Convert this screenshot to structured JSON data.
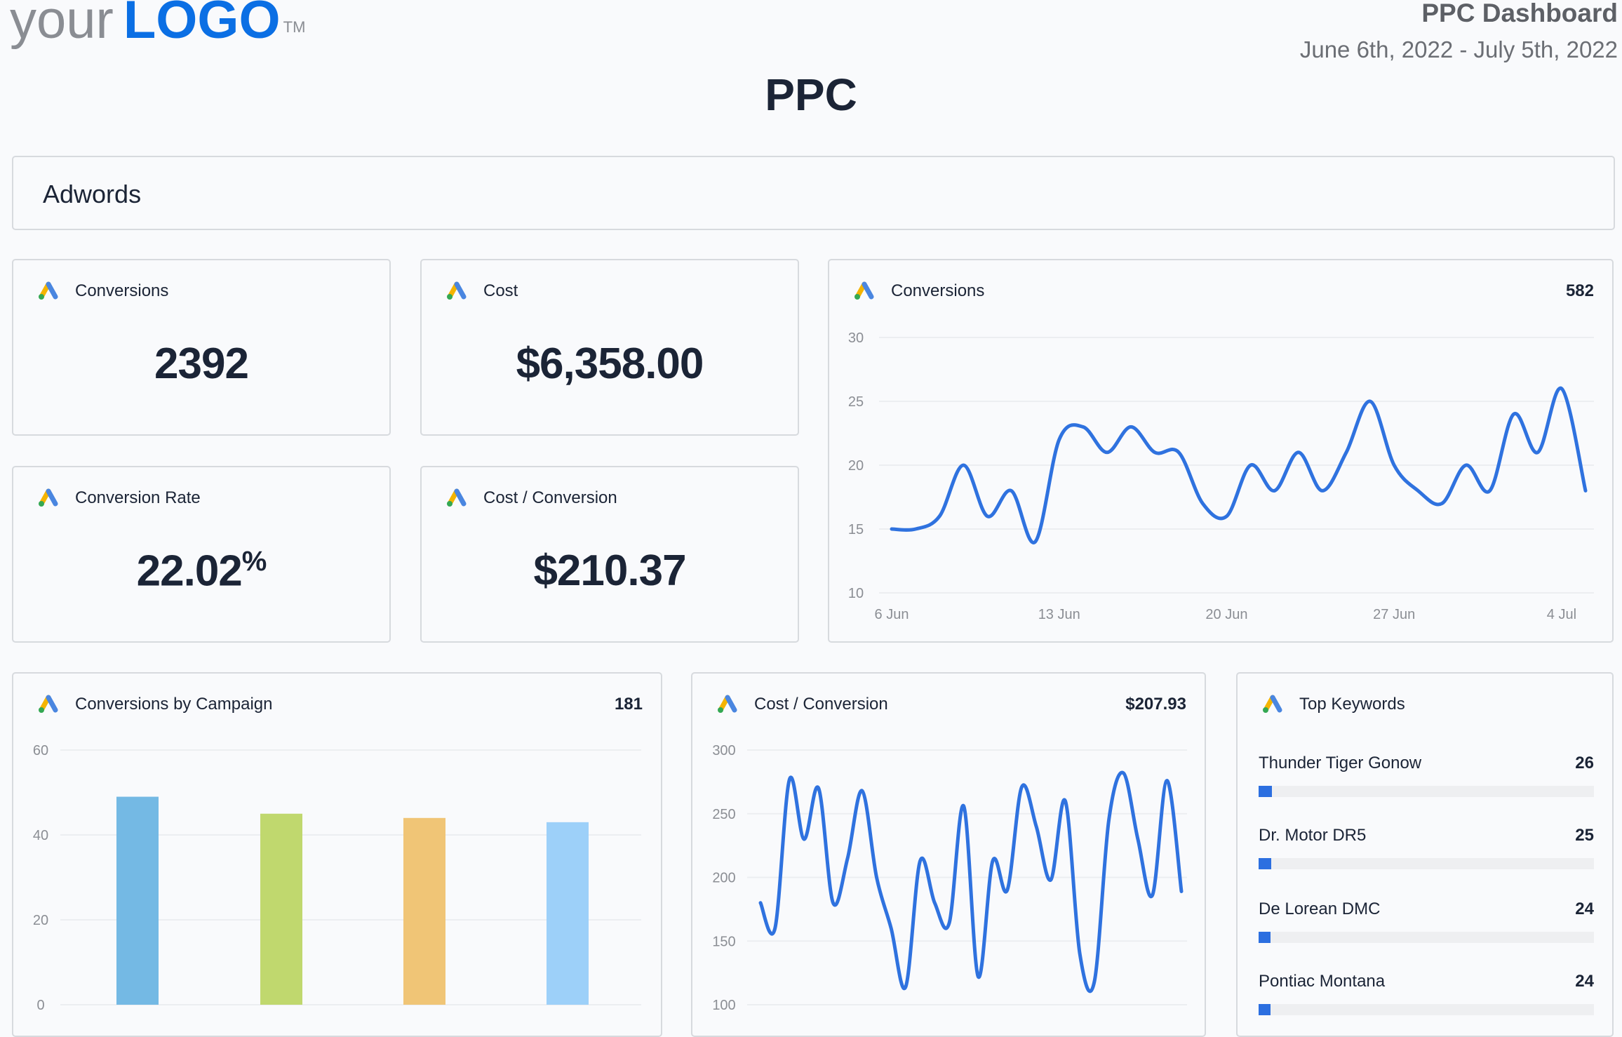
{
  "header": {
    "logo": {
      "prefix": "your",
      "brand": "LOGO",
      "tm": "TM"
    },
    "dashboard_title": "PPC Dashboard",
    "date_range": "June 6th, 2022 - July 5th, 2022",
    "page_title": "PPC"
  },
  "section": {
    "title": "Adwords"
  },
  "colors": {
    "accent": "#2c6fe0",
    "line": "#2f72df",
    "logo_blue": "#0b6fe4",
    "text": "#1b2436"
  },
  "icon": "google-ads-icon",
  "kpis": [
    {
      "title": "Conversions",
      "value": "2392"
    },
    {
      "title": "Cost",
      "value": "$6,358.00"
    },
    {
      "title": "Conversion Rate",
      "value": "22.02",
      "unit": "%"
    },
    {
      "title": "Cost / Conversion",
      "value": "$210.37"
    }
  ],
  "conversions_chart": {
    "title": "Conversions",
    "total": "582"
  },
  "campaign_chart": {
    "title": "Conversions by Campaign",
    "total": "181"
  },
  "cost_chart": {
    "title": "Cost / Conversion",
    "total": "$207.93"
  },
  "keywords": {
    "title": "Top Keywords",
    "items": [
      {
        "name": "Thunder Tiger Gonow",
        "value": "26",
        "fill": 0.04
      },
      {
        "name": "Dr. Motor DR5",
        "value": "25",
        "fill": 0.037
      },
      {
        "name": "De Lorean DMC",
        "value": "24",
        "fill": 0.035
      },
      {
        "name": "Pontiac Montana",
        "value": "24",
        "fill": 0.035
      }
    ]
  },
  "chart_data": [
    {
      "type": "line",
      "title": "Conversions",
      "x_ticks": [
        "6 Jun",
        "13 Jun",
        "20 Jun",
        "27 Jun",
        "4 Jul"
      ],
      "x": [
        "6 Jun",
        "7 Jun",
        "8 Jun",
        "9 Jun",
        "10 Jun",
        "11 Jun",
        "12 Jun",
        "13 Jun",
        "14 Jun",
        "15 Jun",
        "16 Jun",
        "17 Jun",
        "18 Jun",
        "19 Jun",
        "20 Jun",
        "21 Jun",
        "22 Jun",
        "23 Jun",
        "24 Jun",
        "25 Jun",
        "26 Jun",
        "27 Jun",
        "28 Jun",
        "29 Jun",
        "30 Jun",
        "1 Jul",
        "2 Jul",
        "3 Jul",
        "4 Jul",
        "5 Jul"
      ],
      "values": [
        15,
        15,
        16,
        20,
        16,
        18,
        14,
        22,
        23,
        21,
        23,
        21,
        21,
        17,
        16,
        20,
        18,
        21,
        18,
        21,
        25,
        20,
        18,
        17,
        20,
        18,
        24,
        21,
        26,
        18
      ],
      "ylim": [
        10,
        30
      ],
      "y_ticks": [
        10,
        15,
        20,
        25,
        30
      ],
      "grid": true
    },
    {
      "type": "bar",
      "title": "Conversions by Campaign",
      "values": [
        49,
        45,
        44,
        43
      ],
      "colors": [
        "#74b9e4",
        "#c0d86e",
        "#f0c576",
        "#9dd0f9"
      ],
      "ylim": [
        0,
        60
      ],
      "y_ticks": [
        0,
        20,
        40,
        60
      ],
      "grid": true
    },
    {
      "type": "line",
      "title": "Cost / Conversion",
      "x": [
        "6 Jun",
        "7 Jun",
        "8 Jun",
        "9 Jun",
        "10 Jun",
        "11 Jun",
        "12 Jun",
        "13 Jun",
        "14 Jun",
        "15 Jun",
        "16 Jun",
        "17 Jun",
        "18 Jun",
        "19 Jun",
        "20 Jun",
        "21 Jun",
        "22 Jun",
        "23 Jun",
        "24 Jun",
        "25 Jun",
        "26 Jun",
        "27 Jun",
        "28 Jun",
        "29 Jun",
        "30 Jun",
        "1 Jul",
        "2 Jul",
        "3 Jul",
        "4 Jul",
        "5 Jul"
      ],
      "values": [
        180,
        160,
        277,
        230,
        270,
        180,
        215,
        268,
        200,
        160,
        114,
        213,
        180,
        164,
        256,
        122,
        213,
        190,
        271,
        240,
        198,
        260,
        140,
        118,
        245,
        282,
        230,
        186,
        276,
        189
      ],
      "ylim": [
        100,
        300
      ],
      "y_ticks": [
        100,
        150,
        200,
        250,
        300
      ],
      "grid": true
    }
  ]
}
